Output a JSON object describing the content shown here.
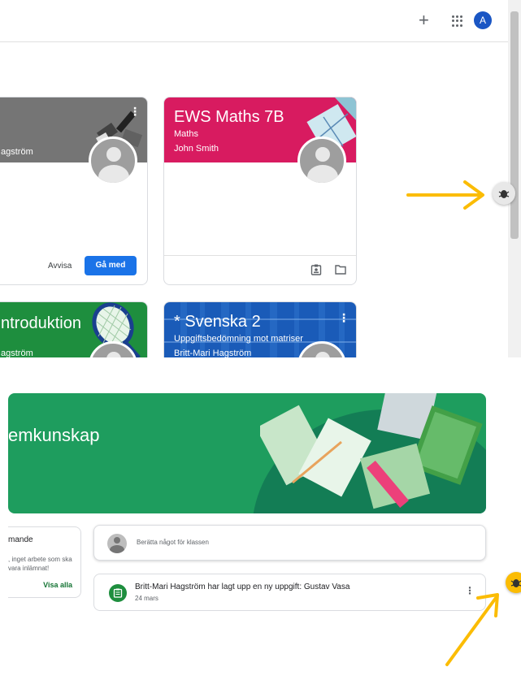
{
  "top": {
    "header": {
      "add_icon": "+",
      "avatar_letter": "A"
    },
    "cards": [
      {
        "title": "",
        "subtitle": "",
        "teacher": "agström",
        "color": "#757575",
        "actions": {
          "reject": "Avvisa",
          "join": "Gå med"
        }
      },
      {
        "title": "EWS Maths 7B",
        "subtitle": "Maths",
        "teacher": "John Smith",
        "color": "#d81b60"
      },
      {
        "title": "ntroduktion",
        "subtitle": "",
        "teacher": "agström",
        "color": "#1e8e3e"
      },
      {
        "title": "* Svenska 2",
        "subtitle": "Uppgiftsbedömning mot matriser",
        "teacher": "Britt-Mari Hagström",
        "color": "#1a5bb8"
      }
    ]
  },
  "bottom": {
    "banner": {
      "title": "emkunskap",
      "color": "#1e9d5e"
    },
    "upcoming": {
      "title": "mande",
      "text": ", inget arbete som ska vara inlämnat!",
      "link": "Visa alla"
    },
    "share": {
      "placeholder": "Berätta något för klassen"
    },
    "post": {
      "title": "Britt-Mari Hagström har lagt upp en ny uppgift: Gustav Vasa",
      "date": "24 mars"
    }
  },
  "colors": {
    "accent_arrow": "#fbbc04",
    "primary_button": "#1a73e8"
  }
}
